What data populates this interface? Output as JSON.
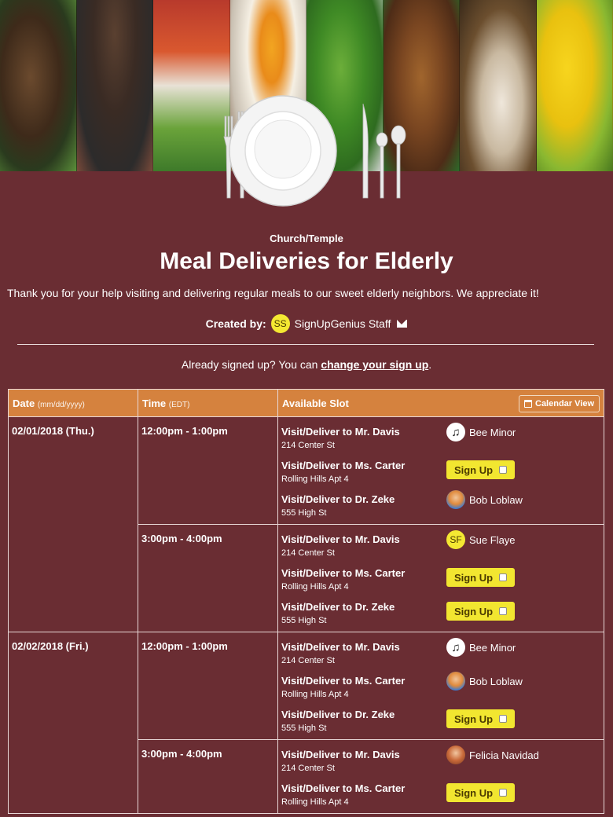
{
  "header": {
    "category": "Church/Temple",
    "title": "Meal Deliveries for Elderly",
    "description": "Thank you for your help visiting and delivering regular meals to our sweet elderly neighbors. We appreciate it!",
    "created_by_label": "Created by:",
    "creator_initials": "SS",
    "creator_name": "SignUpGenius Staff",
    "already_text": "Already signed up? You can",
    "change_link": "change your sign up",
    "already_end": "."
  },
  "table": {
    "col_date": "Date",
    "col_date_hint": "(mm/dd/yyyy)",
    "col_time": "Time",
    "col_time_hint": "(EDT)",
    "col_slot": "Available Slot",
    "calendar_view": "Calendar View",
    "signup_label": "Sign Up",
    "rows": [
      {
        "date": "02/01/2018 (Thu.)",
        "times": [
          {
            "time": "12:00pm - 1:00pm",
            "slots": [
              {
                "title": "Visit/Deliver to Mr. Davis",
                "address": "214 Center St",
                "person": "Bee Minor",
                "icon": "music-note-avatar"
              },
              {
                "title": "Visit/Deliver to Ms. Carter",
                "address": "Rolling Hills Apt 4"
              },
              {
                "title": "Visit/Deliver to Dr. Zeke",
                "address": "555 High St",
                "person": "Bob Loblaw",
                "icon": "photo-avatar"
              }
            ]
          },
          {
            "time": "3:00pm - 4:00pm",
            "slots": [
              {
                "title": "Visit/Deliver to Mr. Davis",
                "address": "214 Center St",
                "person": "Sue Flaye",
                "initials": "SF"
              },
              {
                "title": "Visit/Deliver to Ms. Carter",
                "address": "Rolling Hills Apt 4"
              },
              {
                "title": "Visit/Deliver to Dr. Zeke",
                "address": "555 High St"
              }
            ]
          }
        ]
      },
      {
        "date": "02/02/2018 (Fri.)",
        "times": [
          {
            "time": "12:00pm - 1:00pm",
            "slots": [
              {
                "title": "Visit/Deliver to Mr. Davis",
                "address": "214 Center St",
                "person": "Bee Minor",
                "icon": "music-note-avatar"
              },
              {
                "title": "Visit/Deliver to Ms. Carter",
                "address": "Rolling Hills Apt 4",
                "person": "Bob Loblaw",
                "icon": "photo-avatar"
              },
              {
                "title": "Visit/Deliver to Dr. Zeke",
                "address": "555 High St"
              }
            ]
          },
          {
            "time": "3:00pm - 4:00pm",
            "slots": [
              {
                "title": "Visit/Deliver to Mr. Davis",
                "address": "214 Center St",
                "person": "Felicia Navidad",
                "icon": "photo-avatar"
              },
              {
                "title": "Visit/Deliver to Ms. Carter",
                "address": "Rolling Hills Apt 4"
              }
            ]
          }
        ]
      }
    ]
  },
  "colors": {
    "background": "#6a2d33",
    "header_row": "#d5823e",
    "signup_button": "#f2e630",
    "avatar_yellow": "#f4e832"
  }
}
